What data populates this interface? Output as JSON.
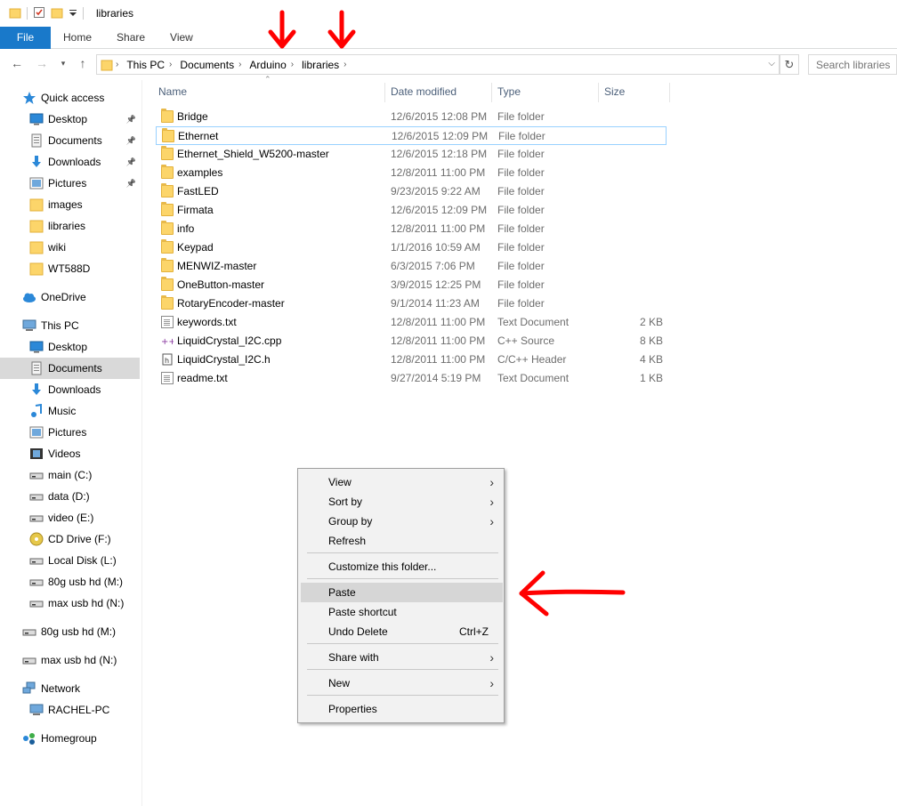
{
  "window": {
    "title": "libraries"
  },
  "ribbon": {
    "tabs": [
      "File",
      "Home",
      "Share",
      "View"
    ]
  },
  "address": {
    "crumbs": [
      "This PC",
      "Documents",
      "Arduino",
      "libraries"
    ],
    "search_placeholder": "Search libraries"
  },
  "sidebar": {
    "items": [
      {
        "label": "Quick access",
        "icon": "star-icon",
        "indent": 1
      },
      {
        "label": "Desktop",
        "icon": "desktop-icon",
        "indent": 2,
        "pinned": true
      },
      {
        "label": "Documents",
        "icon": "documents-icon",
        "indent": 2,
        "pinned": true
      },
      {
        "label": "Downloads",
        "icon": "download-icon",
        "indent": 2,
        "pinned": true
      },
      {
        "label": "Pictures",
        "icon": "pictures-icon",
        "indent": 2,
        "pinned": true
      },
      {
        "label": "images",
        "icon": "folder-icon",
        "indent": 2
      },
      {
        "label": "libraries",
        "icon": "folder-icon",
        "indent": 2
      },
      {
        "label": "wiki",
        "icon": "folder-icon",
        "indent": 2
      },
      {
        "label": "WT588D",
        "icon": "folder-icon",
        "indent": 2
      },
      {
        "label": "OneDrive",
        "icon": "cloud-icon",
        "indent": 1
      },
      {
        "label": "This PC",
        "icon": "computer-icon",
        "indent": 1
      },
      {
        "label": "Desktop",
        "icon": "desktop-icon",
        "indent": 2
      },
      {
        "label": "Documents",
        "icon": "documents-icon",
        "indent": 2,
        "selected": true
      },
      {
        "label": "Downloads",
        "icon": "download-icon",
        "indent": 2
      },
      {
        "label": "Music",
        "icon": "music-icon",
        "indent": 2
      },
      {
        "label": "Pictures",
        "icon": "pictures-icon",
        "indent": 2
      },
      {
        "label": "Videos",
        "icon": "videos-icon",
        "indent": 2
      },
      {
        "label": "main (C:)",
        "icon": "drive-icon",
        "indent": 2
      },
      {
        "label": "data (D:)",
        "icon": "drive-icon",
        "indent": 2
      },
      {
        "label": "video (E:)",
        "icon": "drive-icon",
        "indent": 2
      },
      {
        "label": "CD Drive (F:)",
        "icon": "cd-icon",
        "indent": 2
      },
      {
        "label": "Local Disk (L:)",
        "icon": "drive-icon",
        "indent": 2
      },
      {
        "label": "80g usb hd (M:)",
        "icon": "drive-icon",
        "indent": 2
      },
      {
        "label": "max usb hd (N:)",
        "icon": "drive-icon",
        "indent": 2
      },
      {
        "label": "80g usb hd (M:)",
        "icon": "drive-icon",
        "indent": 1
      },
      {
        "label": "max usb hd (N:)",
        "icon": "drive-icon",
        "indent": 1
      },
      {
        "label": "Network",
        "icon": "network-icon",
        "indent": 1
      },
      {
        "label": "RACHEL-PC",
        "icon": "computer-icon",
        "indent": 2
      },
      {
        "label": "Homegroup",
        "icon": "homegroup-icon",
        "indent": 1
      }
    ]
  },
  "columns": [
    "Name",
    "Date modified",
    "Type",
    "Size"
  ],
  "files": [
    {
      "name": "Bridge",
      "date": "12/6/2015 12:08 PM",
      "type": "File folder",
      "size": "",
      "icon": "folder-icon"
    },
    {
      "name": "Ethernet",
      "date": "12/6/2015 12:09 PM",
      "type": "File folder",
      "size": "",
      "icon": "folder-icon",
      "focused": true
    },
    {
      "name": "Ethernet_Shield_W5200-master",
      "date": "12/6/2015 12:18 PM",
      "type": "File folder",
      "size": "",
      "icon": "folder-icon"
    },
    {
      "name": "examples",
      "date": "12/8/2011 11:00 PM",
      "type": "File folder",
      "size": "",
      "icon": "folder-icon"
    },
    {
      "name": "FastLED",
      "date": "9/23/2015 9:22 AM",
      "type": "File folder",
      "size": "",
      "icon": "folder-icon"
    },
    {
      "name": "Firmata",
      "date": "12/6/2015 12:09 PM",
      "type": "File folder",
      "size": "",
      "icon": "folder-icon"
    },
    {
      "name": "info",
      "date": "12/8/2011 11:00 PM",
      "type": "File folder",
      "size": "",
      "icon": "folder-icon"
    },
    {
      "name": "Keypad",
      "date": "1/1/2016 10:59 AM",
      "type": "File folder",
      "size": "",
      "icon": "folder-icon"
    },
    {
      "name": "MENWIZ-master",
      "date": "6/3/2015 7:06 PM",
      "type": "File folder",
      "size": "",
      "icon": "folder-icon"
    },
    {
      "name": "OneButton-master",
      "date": "3/9/2015 12:25 PM",
      "type": "File folder",
      "size": "",
      "icon": "folder-icon"
    },
    {
      "name": "RotaryEncoder-master",
      "date": "9/1/2014 11:23 AM",
      "type": "File folder",
      "size": "",
      "icon": "folder-icon"
    },
    {
      "name": "keywords.txt",
      "date": "12/8/2011 11:00 PM",
      "type": "Text Document",
      "size": "2 KB",
      "icon": "text-file-icon"
    },
    {
      "name": "LiquidCrystal_I2C.cpp",
      "date": "12/8/2011 11:00 PM",
      "type": "C++ Source",
      "size": "8 KB",
      "icon": "cpp-file-icon"
    },
    {
      "name": "LiquidCrystal_I2C.h",
      "date": "12/8/2011 11:00 PM",
      "type": "C/C++ Header",
      "size": "4 KB",
      "icon": "header-file-icon"
    },
    {
      "name": "readme.txt",
      "date": "9/27/2014 5:19 PM",
      "type": "Text Document",
      "size": "1 KB",
      "icon": "text-file-icon"
    }
  ],
  "context_menu": {
    "items": [
      {
        "label": "View",
        "submenu": true
      },
      {
        "label": "Sort by",
        "submenu": true
      },
      {
        "label": "Group by",
        "submenu": true
      },
      {
        "label": "Refresh"
      },
      {
        "sep": true
      },
      {
        "label": "Customize this folder..."
      },
      {
        "sep": true
      },
      {
        "label": "Paste",
        "highlighted": true
      },
      {
        "label": "Paste shortcut"
      },
      {
        "label": "Undo Delete",
        "shortcut": "Ctrl+Z"
      },
      {
        "sep": true
      },
      {
        "label": "Share with",
        "submenu": true
      },
      {
        "sep": true
      },
      {
        "label": "New",
        "submenu": true
      },
      {
        "sep": true
      },
      {
        "label": "Properties"
      }
    ]
  },
  "colors": {
    "accent": "#1979ca",
    "annotation": "#ff0000",
    "selection": "#d9d9d9"
  }
}
